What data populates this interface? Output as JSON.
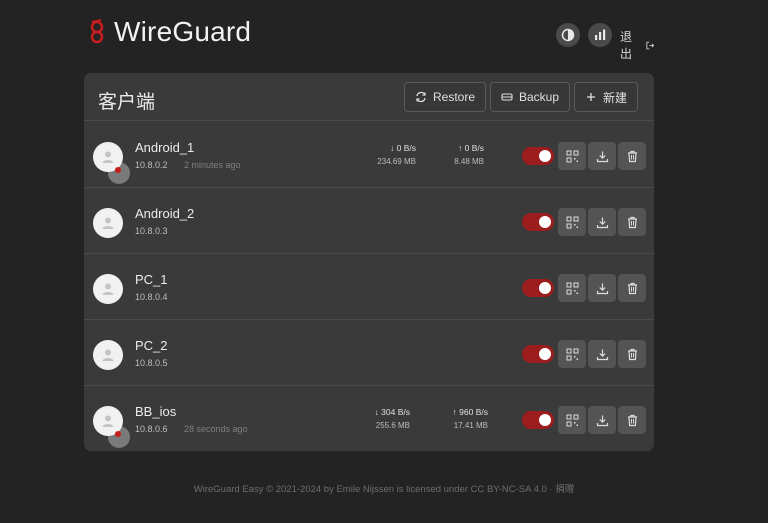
{
  "app": {
    "title": "WireGuard",
    "logout_label": "退出",
    "accent_color": "#c41e1e"
  },
  "panel": {
    "title": "客户端",
    "buttons": {
      "restore": "Restore",
      "backup": "Backup",
      "new": "新建"
    }
  },
  "clients": [
    {
      "name": "Android_1",
      "ip": "10.8.0.2",
      "last_seen": "2 minutes ago",
      "enabled": true,
      "online": true,
      "down_rate": "0 B/s",
      "down_total": "234.69 MB",
      "up_rate": "0 B/s",
      "up_total": "8.48 MB"
    },
    {
      "name": "Android_2",
      "ip": "10.8.0.3",
      "last_seen": "",
      "enabled": true,
      "online": false
    },
    {
      "name": "PC_1",
      "ip": "10.8.0.4",
      "last_seen": "",
      "enabled": true,
      "online": false
    },
    {
      "name": "PC_2",
      "ip": "10.8.0.5",
      "last_seen": "",
      "enabled": true,
      "online": false
    },
    {
      "name": "BB_ios",
      "ip": "10.8.0.6",
      "last_seen": "28 seconds ago",
      "enabled": true,
      "online": true,
      "down_rate": "304 B/s",
      "down_total": "255.6 MB",
      "up_rate": "960 B/s",
      "up_total": "17.41 MB"
    }
  ],
  "footer": {
    "text": "WireGuard Easy © 2021-2024 by Emile Nijssen is licensed under CC BY-NC-SA 4.0 · 捐赠"
  }
}
